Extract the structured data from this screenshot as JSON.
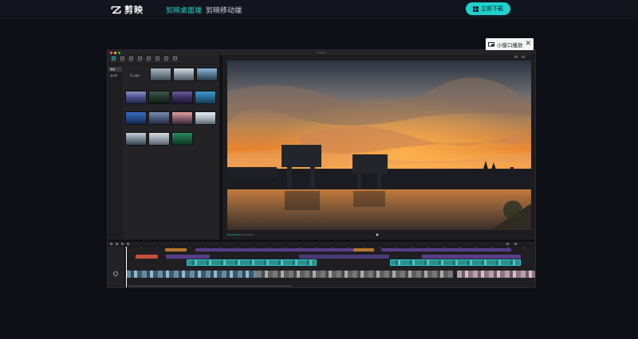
{
  "nav": {
    "brand_name": "剪映",
    "desktop_link": "剪映桌面端",
    "mobile_link": "剪映移动端",
    "download_button": "立即下载"
  },
  "colors": {
    "accent": "#21d6c9",
    "page_bg": "#0d0f17",
    "download_bg": "#1fd1cc"
  },
  "mini_player": {
    "label": "小窗口播放",
    "icon": "monitor-icon",
    "close_icon": "close-icon"
  },
  "editor": {
    "window_title": "CapCut",
    "media_panel": {
      "tools": [
        "media-tool",
        "audio-tool",
        "text-tool",
        "sticker-tool",
        "effects-tool",
        "transitions-tool",
        "filters-tool",
        "adjust-tool"
      ],
      "categories": [
        "本地",
        "素材库"
      ],
      "import_label": "导入素材"
    },
    "preview": {
      "timecode_current": "00:00:00:00",
      "timecode_total": "00:00:26:24"
    }
  }
}
